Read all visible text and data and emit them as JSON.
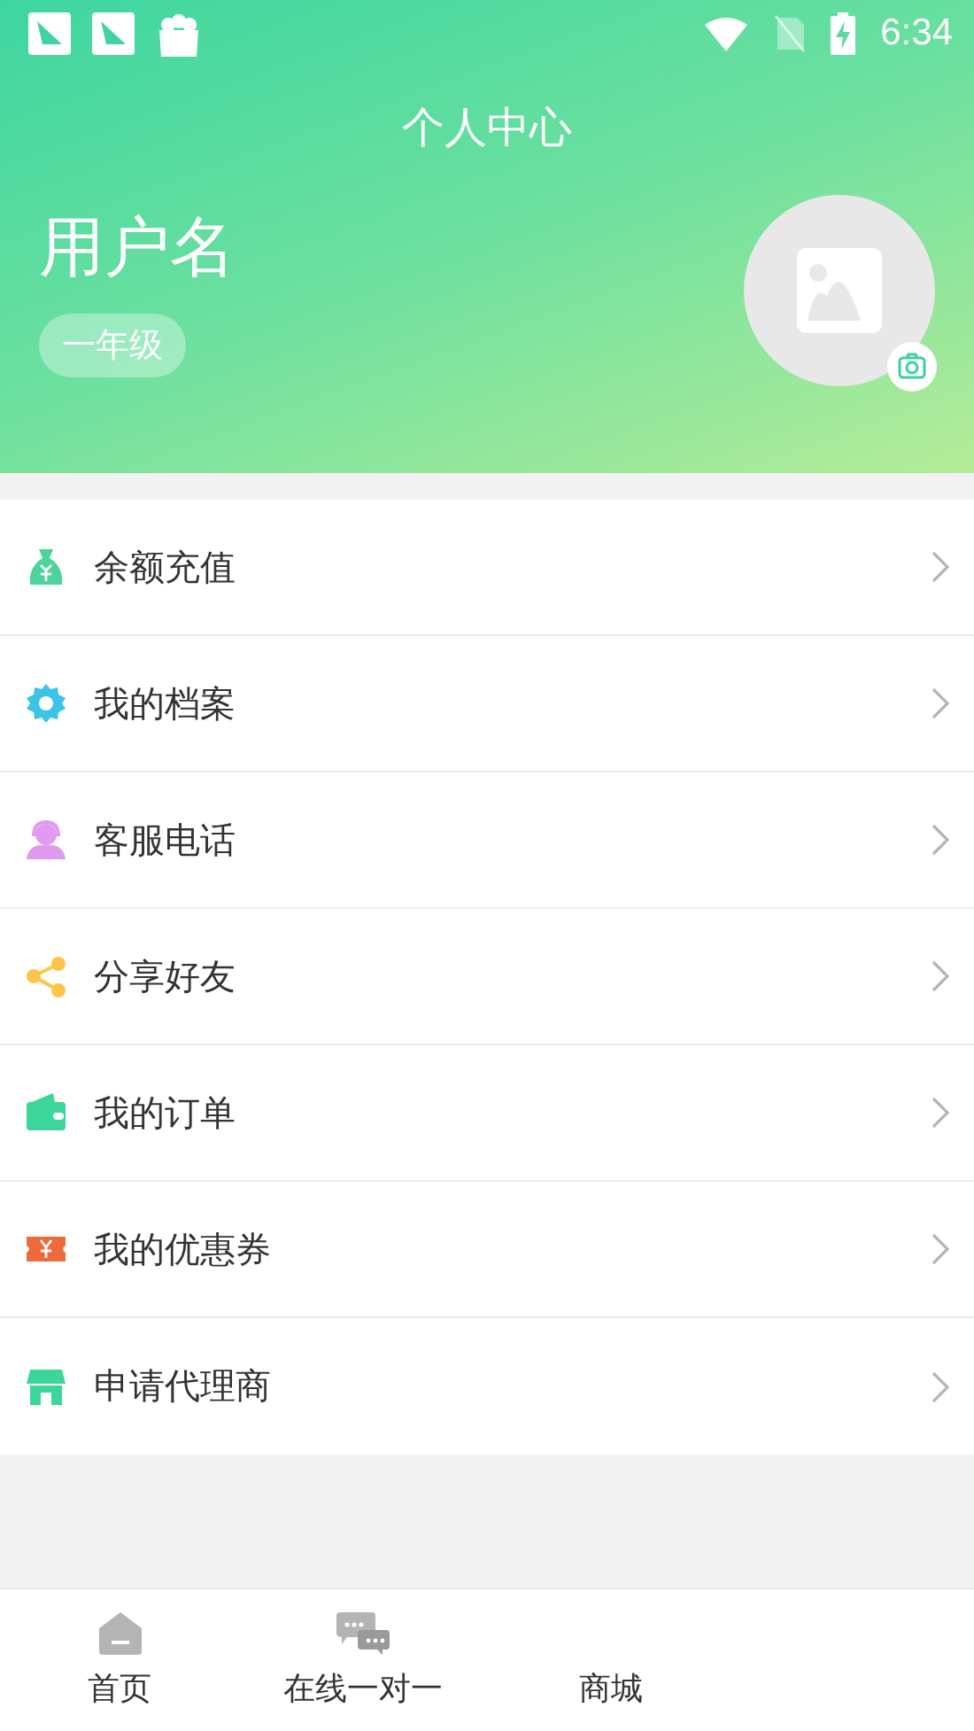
{
  "status_bar": {
    "time": "6:34"
  },
  "header": {
    "title": "个人中心",
    "username": "用户名",
    "grade": "一年级"
  },
  "menu": [
    {
      "label": "余额充值",
      "kind": "money-bag",
      "color": "#4cd49a"
    },
    {
      "label": "我的档案",
      "kind": "gear",
      "color": "#3cc4e8"
    },
    {
      "label": "客服电话",
      "kind": "headset",
      "color": "#e09af0"
    },
    {
      "label": "分享好友",
      "kind": "share",
      "color": "#fdc448"
    },
    {
      "label": "我的订单",
      "kind": "wallet",
      "color": "#3dd69a"
    },
    {
      "label": "我的优惠券",
      "kind": "coupon",
      "color": "#f0693a"
    },
    {
      "label": "申请代理商",
      "kind": "store",
      "color": "#3dd69a"
    }
  ],
  "tabs": [
    {
      "label": "首页",
      "kind": "home",
      "selected": false
    },
    {
      "label": "在线一对一",
      "kind": "chat",
      "selected": false
    },
    {
      "label": "商城",
      "kind": "plain",
      "selected": false
    }
  ]
}
